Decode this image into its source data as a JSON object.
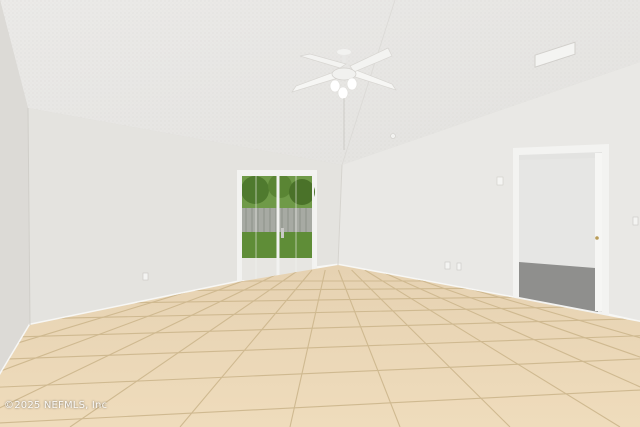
{
  "photo": {
    "watermark": "©2025 NEFMLS, Inc"
  },
  "colors": {
    "ceiling": "#ecebe9",
    "wall_left": "#e3e2de",
    "wall_back": "#e8e7e4",
    "wall_right": "#e6e5e2",
    "wall_far_left": "#dedcd8",
    "baseboard": "#f6f6f4",
    "tile": "#ead7b8",
    "grout": "#cdb894",
    "door_frame": "#f4f4f2",
    "yard_grass": "#5f8a3c",
    "fence": "#9ea39b",
    "carpet": "#8f8f8d"
  }
}
